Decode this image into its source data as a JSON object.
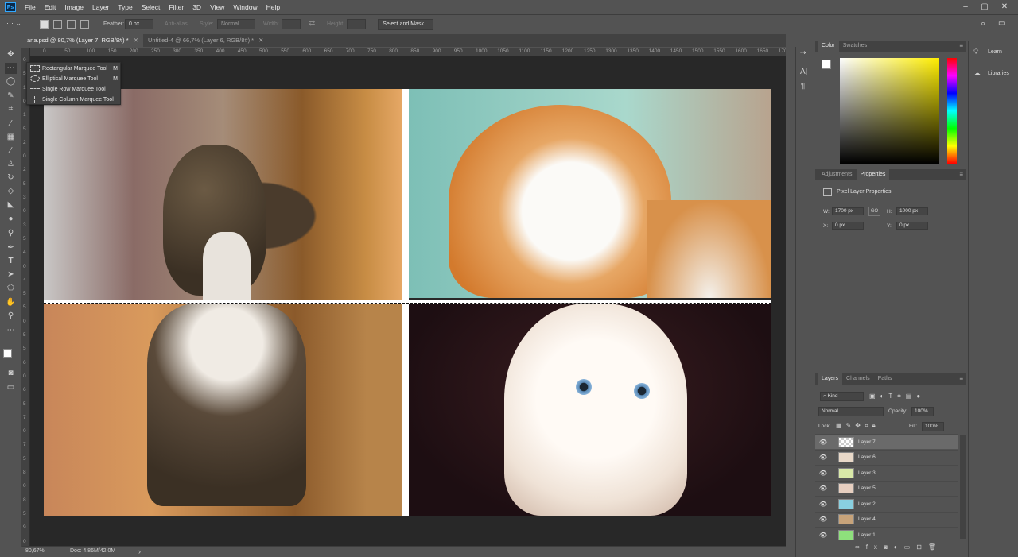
{
  "app": {
    "logo": "Ps"
  },
  "menu": [
    "File",
    "Edit",
    "Image",
    "Layer",
    "Type",
    "Select",
    "Filter",
    "3D",
    "View",
    "Window",
    "Help"
  ],
  "window_controls": [
    "–",
    "▢",
    "✕"
  ],
  "options_bar": {
    "feather_label": "Feather:",
    "feather_value": "0 px",
    "anti_alias_label": "Anti-alias",
    "style_label": "Style:",
    "style_value": "Normal",
    "width_label": "Width:",
    "height_label": "Height:",
    "select_mask_label": "Select and Mask..."
  },
  "tabs": [
    {
      "label": "ana.psd @ 80,7% (Layer 7, RGB/8#) *",
      "close": "✕"
    },
    {
      "label": "Untitled-4 @ 66,7% (Layer 6, RGB/8#) *",
      "close": "✕"
    }
  ],
  "ruler_h": [
    "0",
    "50",
    "100",
    "150",
    "200",
    "250",
    "300",
    "350",
    "400",
    "450",
    "500",
    "550",
    "600",
    "650",
    "700",
    "750",
    "800",
    "850",
    "900",
    "950",
    "1000",
    "1050",
    "1100",
    "1150",
    "1200",
    "1250",
    "1300",
    "1350",
    "1400",
    "1450",
    "1500",
    "1550",
    "1600",
    "1650",
    "1700"
  ],
  "ruler_v": [
    "0",
    "5",
    "1",
    "0",
    "1",
    "5",
    "2",
    "0",
    "2",
    "5",
    "3",
    "0",
    "3",
    "5",
    "4",
    "0",
    "4",
    "5",
    "5",
    "0",
    "5",
    "5",
    "6",
    "0",
    "6",
    "5",
    "7",
    "0",
    "7",
    "5",
    "8",
    "0",
    "8",
    "5",
    "9",
    "0"
  ],
  "flyout": [
    {
      "label": "Rectangular Marquee Tool",
      "key": "M"
    },
    {
      "label": "Elliptical Marquee Tool",
      "key": "M"
    },
    {
      "label": "Single Row Marquee Tool",
      "key": ""
    },
    {
      "label": "Single Column Marquee Tool",
      "key": ""
    }
  ],
  "status": {
    "zoom": "80,67%",
    "doc": "Doc: 4,86M/42,0M",
    "arrow": "›"
  },
  "color_panel": {
    "tabs": [
      "Color",
      "Swatches"
    ]
  },
  "props_panel": {
    "tabs": [
      "Adjustments",
      "Properties"
    ],
    "title": "Pixel Layer Properties",
    "w_label": "W:",
    "w_value": "1700 px",
    "link": "GO",
    "h_label": "H:",
    "h_value": "1000 px",
    "x_label": "X:",
    "x_value": "0 px",
    "y_label": "Y:",
    "y_value": "0 px"
  },
  "layers_panel": {
    "tabs": [
      "Layers",
      "Channels",
      "Paths"
    ],
    "kind_label": "Kind",
    "blend_mode": "Normal",
    "opacity_label": "Opacity:",
    "opacity_value": "100%",
    "lock_label": "Lock:",
    "fill_label": "Fill:",
    "fill_value": "100%",
    "layers": [
      {
        "name": "Layer 7",
        "selected": true,
        "clip": false
      },
      {
        "name": "Layer 6",
        "selected": false,
        "clip": true
      },
      {
        "name": "Layer 3",
        "selected": false,
        "clip": false
      },
      {
        "name": "Layer 5",
        "selected": false,
        "clip": true
      },
      {
        "name": "Layer 2",
        "selected": false,
        "clip": false
      },
      {
        "name": "Layer 4",
        "selected": false,
        "clip": true
      },
      {
        "name": "Layer 1",
        "selected": false,
        "clip": false
      }
    ],
    "footer_icons": [
      "link-icon",
      "fx-icon",
      "mask-icon",
      "adjustment-icon",
      "group-icon",
      "new-layer-icon",
      "trash-icon"
    ]
  },
  "learn_panel": {
    "learn": "Learn",
    "libraries": "Libraries"
  },
  "colors": {
    "accent": "#31a8ff",
    "panel": "#535353",
    "dark": "#424242",
    "canvas_bg": "#282828"
  }
}
